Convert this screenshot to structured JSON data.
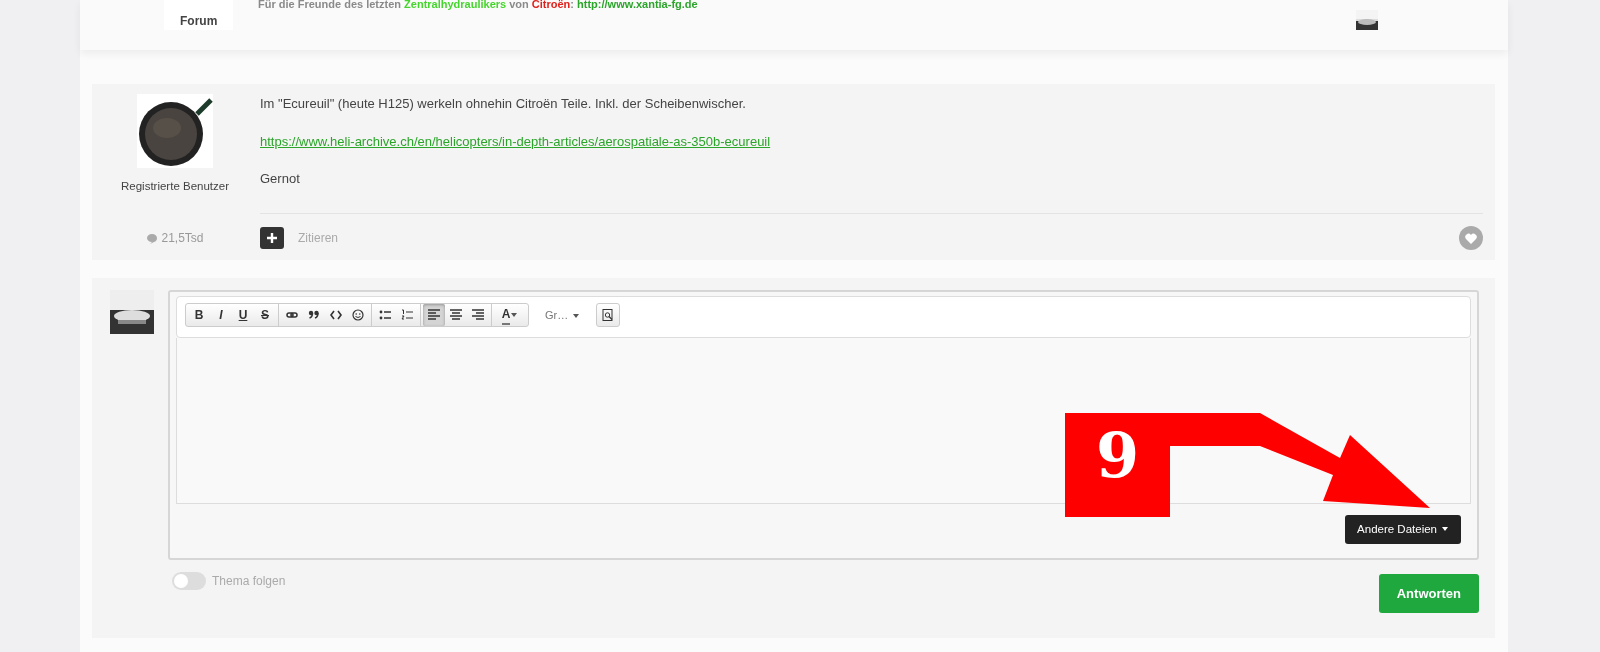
{
  "header": {
    "tagline": [
      {
        "text": "Für die Freunde des letzten ",
        "color": "#8a8a8a"
      },
      {
        "text": "Zentralhydraulikers",
        "color": "#44d62c"
      },
      {
        "text": " von ",
        "color": "#8a8a8a"
      },
      {
        "text": "Citroën",
        "color": "#e0201b"
      },
      {
        "text": ": "
      },
      {
        "text": "http://www.xantia-fg.de",
        "color": "#2aa52a",
        "link": true
      }
    ],
    "tabs": [
      {
        "label": "Forum",
        "selected": true
      }
    ]
  },
  "post": {
    "author_role": "Registrierte Benutzer",
    "post_count": "21,5Tsd",
    "paragraphs": [
      {
        "kind": "text",
        "text": "Im \"Ecureuil\" (heute H125) werkeln ohnehin Citroën Teile. Inkl. der Scheibenwischer."
      },
      {
        "kind": "link",
        "text": "https://www.heli-archive.ch/en/helicopters/in-depth-articles/aerospatiale-as-350b-ecureuil"
      },
      {
        "kind": "text",
        "text": "Gernot"
      }
    ],
    "quote_label": "Zitieren",
    "liked": false
  },
  "editor": {
    "toolbar": [
      {
        "kind": "bold",
        "label": "B",
        "selected": false
      },
      {
        "kind": "italic",
        "label": "I",
        "selected": false
      },
      {
        "kind": "underline",
        "label": "U",
        "selected": false
      },
      {
        "kind": "strike",
        "label": "S",
        "selected": false
      },
      {
        "kind": "link",
        "selected": false
      },
      {
        "kind": "quote",
        "selected": false
      },
      {
        "kind": "code",
        "selected": false
      },
      {
        "kind": "emoji",
        "selected": false
      },
      {
        "kind": "bullets",
        "selected": false
      },
      {
        "kind": "numbers",
        "selected": false
      },
      {
        "kind": "align-left",
        "selected": true
      },
      {
        "kind": "align-center",
        "selected": false
      },
      {
        "kind": "align-right",
        "selected": false
      },
      {
        "kind": "color",
        "label": "A",
        "selected": false
      }
    ],
    "size_label": "Gr…",
    "files_button": "Andere Dateien"
  },
  "follow": {
    "label": "Thema folgen",
    "on": false
  },
  "submit": "Antworten",
  "annotation": {
    "number": "9"
  }
}
